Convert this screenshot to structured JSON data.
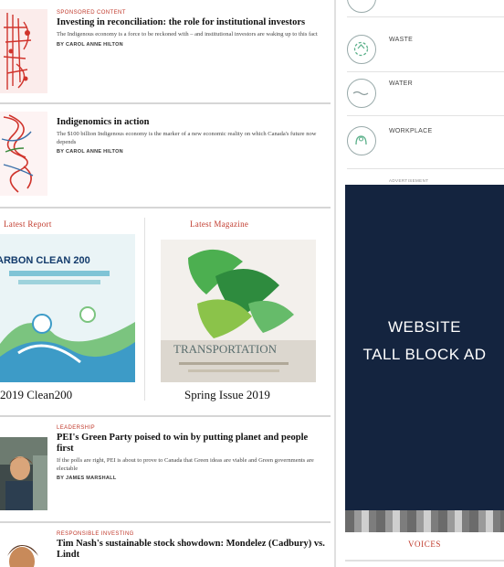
{
  "articles": [
    {
      "kicker": "Sponsored content",
      "title": "Investing in reconciliation: the role for institutional investors",
      "desc": "The Indigenous economy is a force to be reckoned with – and institutional investors are waking up to this fact",
      "byline": "By Carol Anne Hilton"
    },
    {
      "kicker": "",
      "title": "Indigenomics in action",
      "desc": "The $100 billion Indigenous economy is the marker of a new economic reality on which Canada's future now depends",
      "byline": "By Carol Anne Hilton"
    },
    {
      "kicker": "Leadership",
      "title": "PEI's Green Party poised to win by putting planet and people first",
      "desc": "If the polls are right, PEI is about to prove to Canada that Green ideas are viable and Green governments are electable",
      "byline": "By James Marshall"
    },
    {
      "kicker": "Responsible investing",
      "title": "Tim Nash's sustainable stock showdown: Mondelez (Cadbury) vs. Lindt",
      "desc": "",
      "byline": ""
    }
  ],
  "latest_report": {
    "label": "Latest Report",
    "cover_title": "ARBON CLEAN 200",
    "caption": "2019 Clean200"
  },
  "latest_magazine": {
    "label": "Latest Magazine",
    "cover_title": "TRANSPORTATION",
    "caption": "Spring Issue 2019"
  },
  "topics": [
    {
      "label": "WASTE",
      "icon": "recycle-icon"
    },
    {
      "label": "WATER",
      "icon": "water-icon"
    },
    {
      "label": "WORKPLACE",
      "icon": "workplace-icon"
    }
  ],
  "advertisement_label": "ADVERTISEMENT",
  "ad": {
    "line1": "WEBSITE",
    "line2": "TALL BLOCK AD"
  },
  "voices_label": "VOICES",
  "colors": {
    "accent": "#c0392b",
    "ad_bg": "#14243f"
  }
}
